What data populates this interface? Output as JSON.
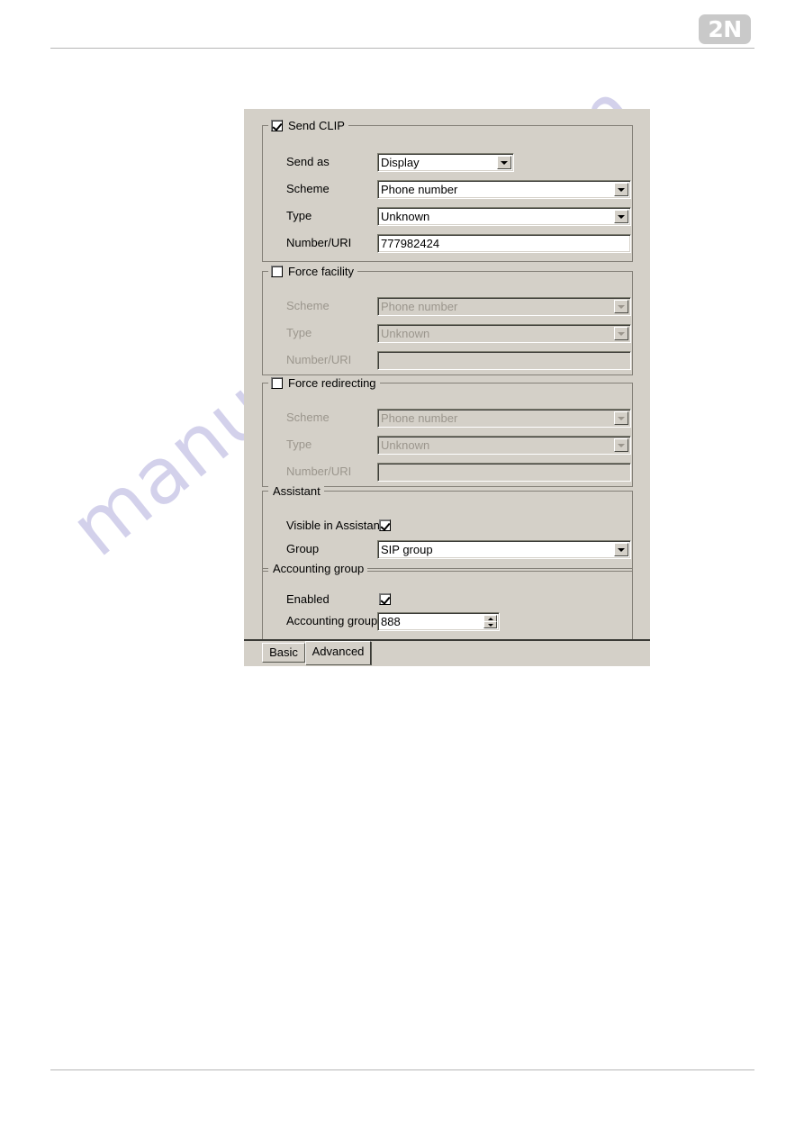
{
  "page": {
    "brand_logo": "2N",
    "watermark": "manualshive.com"
  },
  "dialog": {
    "groups": [
      {
        "id": "send-clip",
        "legend": "Send CLIP",
        "has_checkbox": true,
        "checked": true,
        "enabled": true,
        "fields": [
          {
            "label": "Send as",
            "type": "combo",
            "value": "Display",
            "width": "narrow"
          },
          {
            "label": "Scheme",
            "type": "combo",
            "value": "Phone number",
            "width": "wide"
          },
          {
            "label": "Type",
            "type": "combo",
            "value": "Unknown",
            "width": "wide"
          },
          {
            "label": "Number/URI",
            "type": "text",
            "value": "777982424",
            "width": "wide"
          }
        ]
      },
      {
        "id": "force-facility",
        "legend": "Force facility",
        "has_checkbox": true,
        "checked": false,
        "enabled": false,
        "fields": [
          {
            "label": "Scheme",
            "type": "combo",
            "value": "Phone number",
            "width": "wide"
          },
          {
            "label": "Type",
            "type": "combo",
            "value": "Unknown",
            "width": "wide"
          },
          {
            "label": "Number/URI",
            "type": "text",
            "value": "",
            "width": "wide"
          }
        ]
      },
      {
        "id": "force-redirecting",
        "legend": "Force redirecting",
        "has_checkbox": true,
        "checked": false,
        "enabled": false,
        "fields": [
          {
            "label": "Scheme",
            "type": "combo",
            "value": "Phone number",
            "width": "wide"
          },
          {
            "label": "Type",
            "type": "combo",
            "value": "Unknown",
            "width": "wide"
          },
          {
            "label": "Number/URI",
            "type": "text",
            "value": "",
            "width": "wide"
          }
        ]
      },
      {
        "id": "assistant",
        "legend": "Assistant",
        "has_checkbox": false,
        "enabled": true,
        "fields": [
          {
            "label": "Visible in Assistant",
            "type": "checkbox",
            "checked": true
          },
          {
            "label": "Group",
            "type": "combo",
            "value": "SIP group",
            "width": "wide"
          }
        ]
      },
      {
        "id": "accounting-group",
        "legend": "Accounting group",
        "has_checkbox": false,
        "enabled": true,
        "fields": [
          {
            "label": "Enabled",
            "type": "checkbox",
            "checked": true
          },
          {
            "label": "Accounting group",
            "type": "spinner",
            "value": "888"
          }
        ]
      }
    ],
    "tabs": [
      {
        "label": "Basic",
        "active": false
      },
      {
        "label": "Advanced",
        "active": true
      }
    ]
  }
}
